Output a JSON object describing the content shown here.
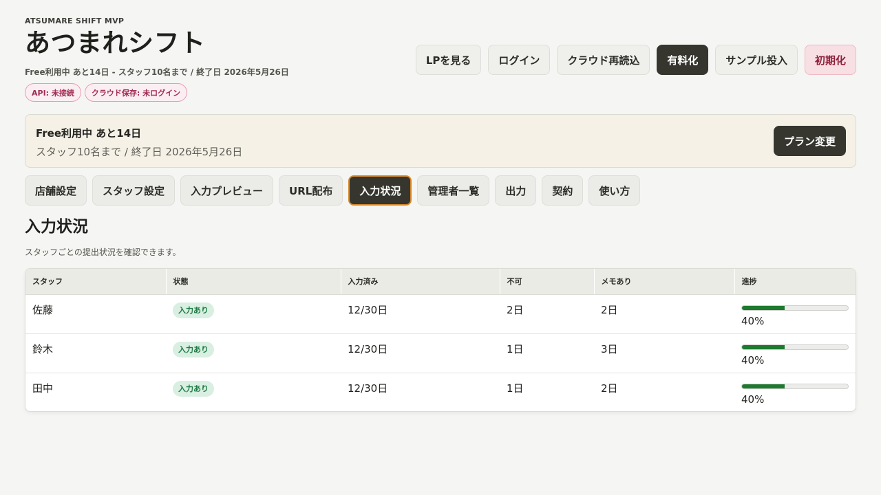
{
  "header": {
    "eyebrow": "ATSUMARE SHIFT MVP",
    "title": "あつまれシフト",
    "plan_line": "Free利用中 あと14日 - スタッフ10名まで / 終了日 2026年5月26日",
    "badges": [
      "API: 未接続",
      "クラウド保存: 未ログイン"
    ],
    "actions": [
      "LPを見る",
      "ログイン",
      "クラウド再読込",
      "有料化",
      "サンプル投入",
      "初期化"
    ]
  },
  "plan_card": {
    "title": "Free利用中 あと14日",
    "subtitle": "スタッフ10名まで / 終了日 2026年5月26日",
    "button": "プラン変更"
  },
  "tabs": [
    "店舗設定",
    "スタッフ設定",
    "入力プレビュー",
    "URL配布",
    "入力状況",
    "管理者一覧",
    "出力",
    "契約",
    "使い方"
  ],
  "active_tab": "入力状況",
  "section": {
    "title": "入力状況",
    "description": "スタッフごとの提出状況を確認できます。"
  },
  "table": {
    "columns": [
      "スタッフ",
      "状態",
      "入力済み",
      "不可",
      "メモあり",
      "進捗"
    ],
    "rows": [
      {
        "staff": "佐藤",
        "status": "入力あり",
        "entered": "12/30日",
        "unavailable": "2日",
        "memo": "2日",
        "progress": 40,
        "progress_label": "40%"
      },
      {
        "staff": "鈴木",
        "status": "入力あり",
        "entered": "12/30日",
        "unavailable": "1日",
        "memo": "3日",
        "progress": 40,
        "progress_label": "40%"
      },
      {
        "staff": "田中",
        "status": "入力あり",
        "entered": "12/30日",
        "unavailable": "1日",
        "memo": "2日",
        "progress": 40,
        "progress_label": "40%"
      }
    ]
  },
  "colors": {
    "background": "#f5f5f3",
    "dark_button": "#36362f",
    "danger_button": "#f8dfe4",
    "status_green": "#1f7a45",
    "progress_green": "#1e7a2f",
    "active_tab_border": "#d98a2b",
    "badge_pink": "#a12c53"
  }
}
